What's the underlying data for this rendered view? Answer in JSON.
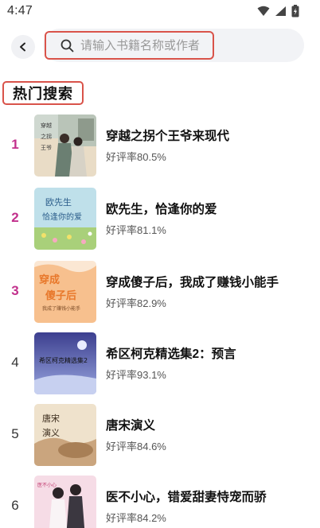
{
  "status_bar": {
    "time": "4:47"
  },
  "search": {
    "placeholder": "请输入书籍名称或作者"
  },
  "section": {
    "title": "热门搜索"
  },
  "books": [
    {
      "rank": "1",
      "title": "穿越之拐个王爷来现代",
      "rating": "好评率80.5%",
      "rank_style": "top"
    },
    {
      "rank": "2",
      "title": "欧先生，恰逢你的爱",
      "rating": "好评率81.1%",
      "rank_style": "top"
    },
    {
      "rank": "3",
      "title": "穿成傻子后，我成了赚钱小能手",
      "rating": "好评率82.9%",
      "rank_style": "top"
    },
    {
      "rank": "4",
      "title": "希区柯克精选集2：预言",
      "rating": "好评率93.1%",
      "rank_style": "normal"
    },
    {
      "rank": "5",
      "title": "唐宋演义",
      "rating": "好评率84.6%",
      "rank_style": "normal"
    },
    {
      "rank": "6",
      "title": "医不小心，错爱甜妻恃宠而骄",
      "rating": "好评率84.2%",
      "rank_style": "normal"
    }
  ],
  "covers": [
    {
      "art_text": "穿越之拐个王爷来现代",
      "icon": "cover-costume-drama"
    },
    {
      "art_text": "欧先生 恰逢你的爱",
      "icon": "cover-flower-field"
    },
    {
      "art_text": "穿成傻子后",
      "sub_text": "我成了赚钱小能手",
      "icon": "cover-orange-title"
    },
    {
      "art_text": "希区柯克精选集2",
      "icon": "cover-night-sky"
    },
    {
      "art_text": "唐宋演义",
      "icon": "cover-beige-beast"
    },
    {
      "art_text": "医不小心",
      "icon": "cover-couple-pink"
    }
  ],
  "colors": {
    "accent_rank": "#c2308c",
    "highlight_border": "#d9534a",
    "search_bg": "#f2f3f6"
  }
}
